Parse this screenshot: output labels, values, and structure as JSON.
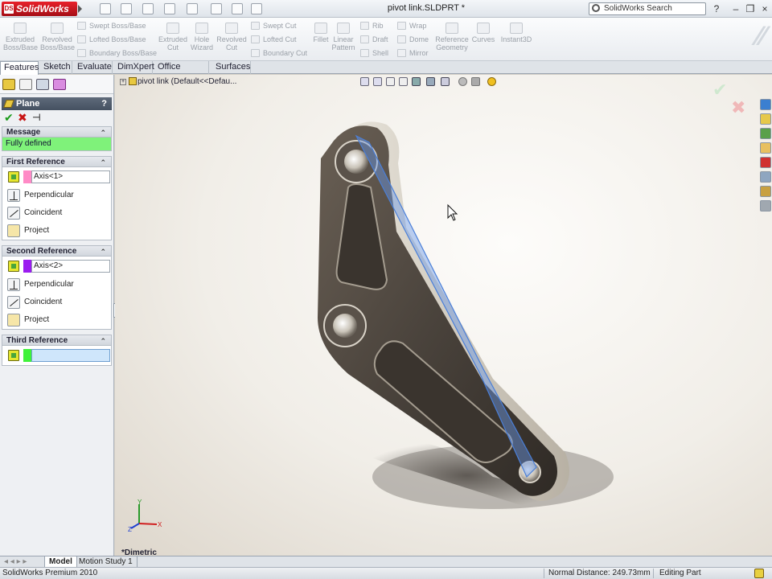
{
  "app": {
    "logo_text": "SolidWorks",
    "logo_badge": "DS",
    "document_title": "pivot link.SLDPRT *",
    "search_placeholder": "SolidWorks Search"
  },
  "window_controls": {
    "help": "?",
    "minimize": "–",
    "restore": "❐",
    "close": "×"
  },
  "commands": {
    "extruded_boss": "Extruded Boss/Base",
    "revolved_boss": "Revolved Boss/Base",
    "swept_boss": "Swept Boss/Base",
    "lofted_boss": "Lofted Boss/Base",
    "boundary_boss": "Boundary Boss/Base",
    "extruded_cut": "Extruded Cut",
    "hole_wizard": "Hole Wizard",
    "revolved_cut": "Revolved Cut",
    "swept_cut": "Swept Cut",
    "lofted_cut": "Lofted Cut",
    "boundary_cut": "Boundary Cut",
    "fillet": "Fillet",
    "linear_pattern": "Linear Pattern",
    "rib": "Rib",
    "draft": "Draft",
    "shell": "Shell",
    "wrap": "Wrap",
    "dome": "Dome",
    "mirror": "Mirror",
    "reference_geometry": "Reference Geometry",
    "curves": "Curves",
    "instant3d": "Instant3D"
  },
  "tabs": [
    "Features",
    "Sketch",
    "Evaluate",
    "DimXpert",
    "Office Products",
    "Surfaces"
  ],
  "property_manager": {
    "title": "Plane",
    "help": "?",
    "ok": "✔",
    "cancel": "✖",
    "pin": "⊣",
    "message": {
      "header": "Message",
      "text": "Fully defined"
    },
    "first_reference": {
      "header": "First Reference",
      "value": "Axis<1>",
      "color": "#ff8ac6",
      "options": [
        "Perpendicular",
        "Coincident",
        "Project"
      ]
    },
    "second_reference": {
      "header": "Second Reference",
      "value": "Axis<2>",
      "color": "#9b1cf0",
      "options": [
        "Perpendicular",
        "Coincident",
        "Project"
      ]
    },
    "third_reference": {
      "header": "Third Reference",
      "value": "",
      "color": "#3ff23a"
    },
    "collapse_glyph": "⌃"
  },
  "viewport": {
    "tree_title": "pivot link  (Default<<Defau...",
    "view_name": "*Dimetric",
    "triad_labels": {
      "x": "X",
      "y": "Y",
      "z": "Z"
    }
  },
  "bottom_tabs": [
    "Model",
    "Motion Study 1"
  ],
  "status": {
    "product": "SolidWorks Premium 2010",
    "distance": "Normal Distance: 249.73mm",
    "mode": "Editing Part"
  },
  "colors": {
    "accent_green": "#7ff27a",
    "sw_red": "#c0141c",
    "plane_blue": "#4a7fd8"
  }
}
